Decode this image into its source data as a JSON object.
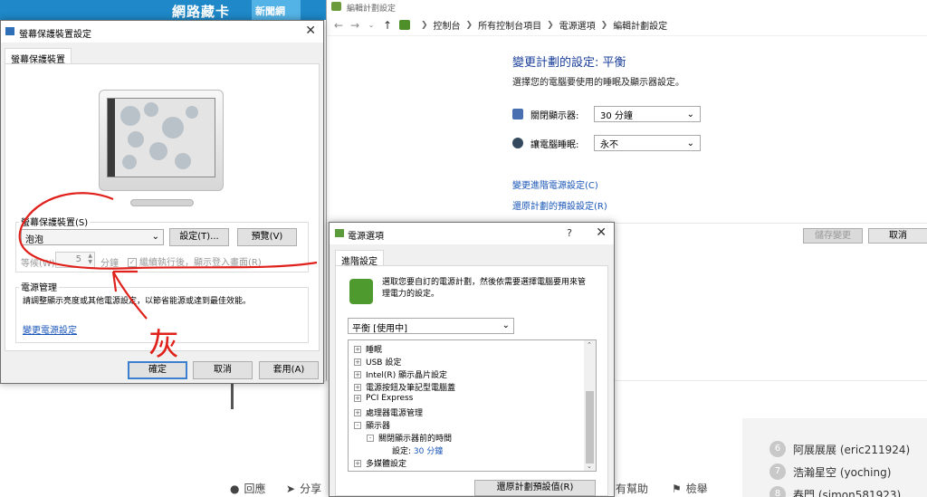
{
  "background": {
    "banner_title": "網路藏卡",
    "banner_tab": "新聞網"
  },
  "bg_page": {
    "actions": [
      {
        "icon": "speech-bubble-icon",
        "label": "回應"
      },
      {
        "icon": "share-icon",
        "label": "分享"
      },
      {
        "icon": "",
        "label": "有幫助"
      },
      {
        "icon": "flag-icon",
        "label": "檢舉"
      }
    ],
    "users": [
      {
        "num": "6",
        "name": "阿展展展 (eric211924)"
      },
      {
        "num": "7",
        "name": "浩瀚星空 (yoching)"
      },
      {
        "num": "8",
        "name": "春門 (simon581923)"
      }
    ]
  },
  "control_panel": {
    "title": "編輯計劃設定",
    "breadcrumb": [
      "控制台",
      "所有控制台項目",
      "電源選項",
      "編輯計劃設定"
    ],
    "heading": "變更計劃的設定: 平衡",
    "subtitle": "選擇您的電腦要使用的睡眠及顯示器設定。",
    "display_label": "關閉顯示器:",
    "display_value": "30 分鐘",
    "sleep_label": "讓電腦睡眠:",
    "sleep_value": "永不",
    "link_advanced": "變更進階電源設定(C)",
    "link_restore": "還原計劃的預設設定(R)",
    "save_label": "儲存變更",
    "cancel_label": "取消"
  },
  "screensaver_dialog": {
    "title": "螢幕保護裝置設定",
    "tab": "螢幕保護裝置",
    "group_label": "螢幕保護裝置(S)",
    "selected": "泡泡",
    "settings_label": "設定(T)...",
    "preview_label": "預覽(V)",
    "wait_label": "等候(W):",
    "wait_value": "5",
    "wait_unit": "分鐘",
    "resume_label": "繼續執行後，顯示登入畫面(R)",
    "power_group_label": "電源管理",
    "power_desc": "請調整顯示亮度或其他電源設定，以節省能源或達到最佳效能。",
    "power_link": "變更電源設定",
    "ok_label": "確定",
    "cancel_label": "取消",
    "apply_label": "套用(A)",
    "annotation": "灰"
  },
  "power_dialog": {
    "title": "電源選項",
    "help": "?",
    "tab": "進階設定",
    "desc": "選取您要自訂的電源計劃，然後依需要選擇電腦要用來管理電力的設定。",
    "plan": "平衡 [使用中]",
    "tree": [
      {
        "level": 0,
        "sign": "+",
        "label": "睡眠"
      },
      {
        "level": 0,
        "sign": "+",
        "label": "USB 設定"
      },
      {
        "level": 0,
        "sign": "+",
        "label": "Intel(R) 顯示晶片設定"
      },
      {
        "level": 0,
        "sign": "+",
        "label": "電源按鈕及筆記型電腦蓋"
      },
      {
        "level": 0,
        "sign": "+",
        "label": "PCI Express"
      },
      {
        "level": 0,
        "sign": "+",
        "label": "處理器電源管理"
      },
      {
        "level": 0,
        "sign": "-",
        "label": "顯示器"
      },
      {
        "level": 1,
        "sign": "-",
        "label": "關閉顯示器前的時間"
      },
      {
        "level": 2,
        "sign": "",
        "label": "設定: ",
        "value": "30 分鐘"
      },
      {
        "level": 0,
        "sign": "+",
        "label": "多媒體設定"
      }
    ],
    "restore_label": "還原計劃預設值(R)"
  },
  "colors": {
    "annotation_red": "#e0201a",
    "link_blue": "#1a56b8",
    "heading_blue": "#1a3e9a",
    "banner_blue": "#1e88c8"
  }
}
